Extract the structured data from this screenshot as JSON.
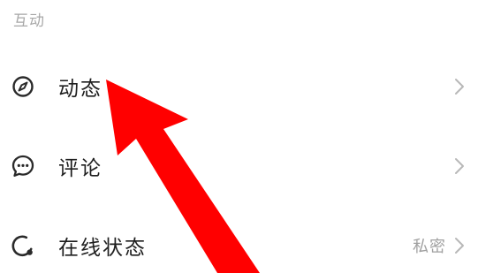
{
  "section": {
    "title": "互动"
  },
  "rows": [
    {
      "label": "动态",
      "icon": "compass-icon",
      "value": ""
    },
    {
      "label": "评论",
      "icon": "comment-icon",
      "value": ""
    },
    {
      "label": "在线状态",
      "icon": "online-status-icon",
      "value": "私密"
    }
  ],
  "annotation": {
    "arrow_color": "#ff0000"
  },
  "colors": {
    "text_primary": "#1e1e1e",
    "text_secondary": "#a0a0a0",
    "icon": "#2a2a2a",
    "chevron": "#b8b8b8"
  }
}
